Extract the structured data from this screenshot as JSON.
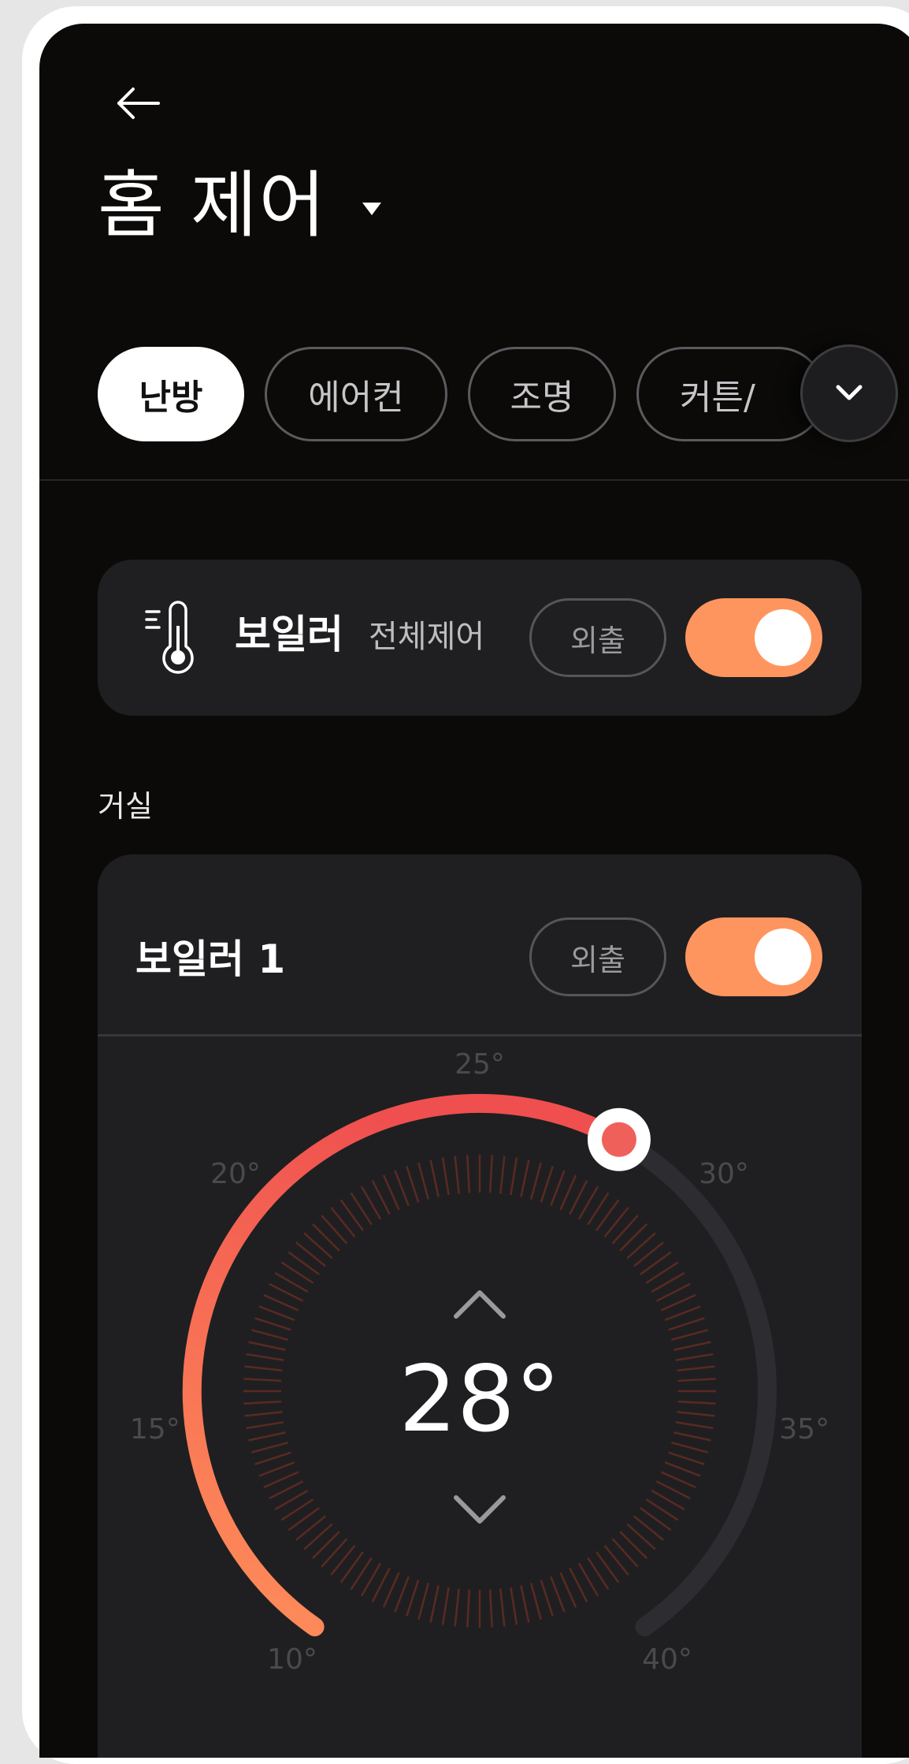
{
  "header": {
    "back_label": "←",
    "title": "홈 제어"
  },
  "tabs": [
    {
      "label": "난방",
      "active": true
    },
    {
      "label": "에어컨",
      "active": false
    },
    {
      "label": "조명",
      "active": false
    },
    {
      "label": "커튼/",
      "active": false
    }
  ],
  "master_control": {
    "name": "보일러",
    "subtitle": "전체제어",
    "away_label": "외출",
    "power_on": true
  },
  "room": {
    "label": "거실"
  },
  "boiler": {
    "name": "보일러 1",
    "away_label": "외출",
    "power_on": true,
    "current_temp": 28,
    "temp_display": "28°",
    "scale_min": 10,
    "scale_max": 40,
    "scale_labels": [
      "10°",
      "15°",
      "20°",
      "25°",
      "30°",
      "35°",
      "40°"
    ]
  },
  "colors": {
    "background": "#0b0a09",
    "card": "#1f1f21",
    "accent_orange": "#ff955e",
    "arc_start": "#ff8f5a",
    "arc_end": "#ef4f4f",
    "inactive_track": "#2c2c31"
  },
  "icons": [
    "back-arrow-icon",
    "caret-down-icon",
    "chevron-down-icon",
    "thermometer-icon",
    "chevron-up-icon"
  ]
}
